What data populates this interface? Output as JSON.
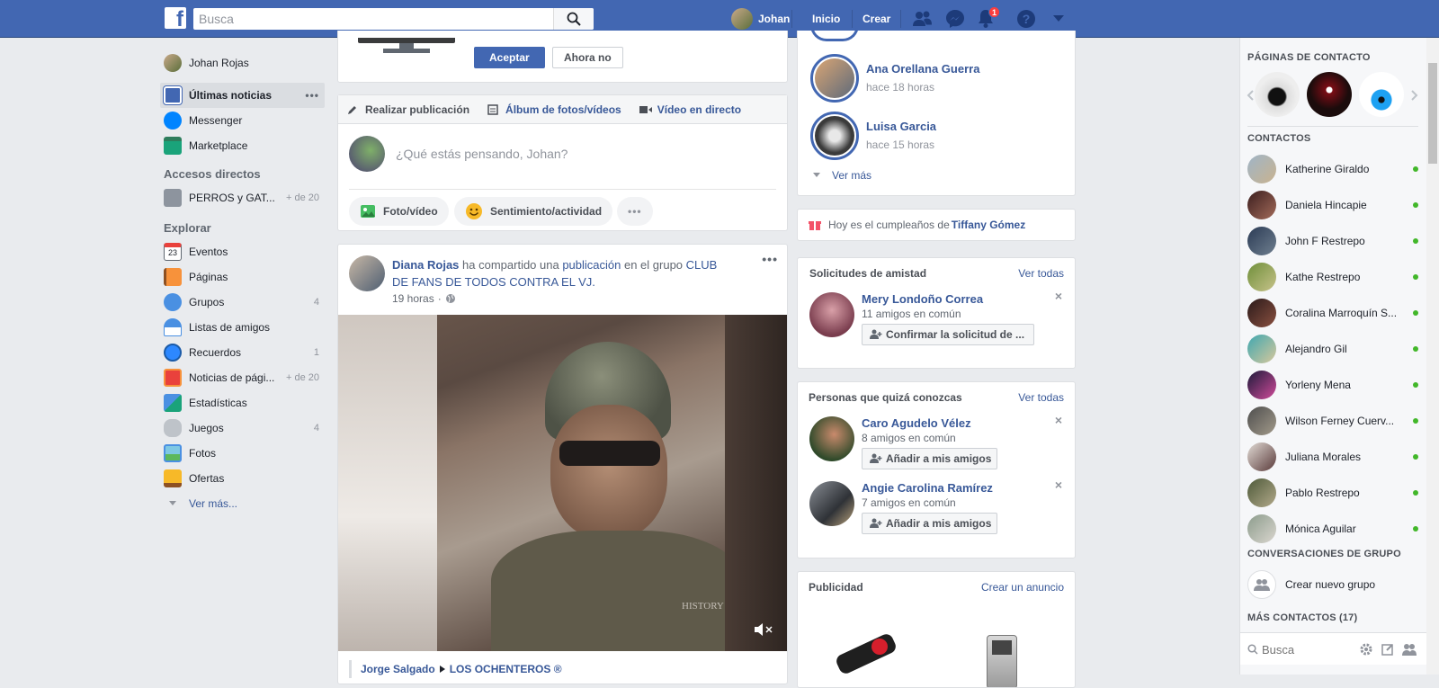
{
  "topbar": {
    "logo": "f",
    "search_placeholder": "Busca",
    "user_name": "Johan",
    "nav_home": "Inicio",
    "nav_create": "Crear",
    "notifications_count": "1",
    "color": "#4267b2"
  },
  "left_nav": {
    "profile_name": "Johan Rojas",
    "items_top": [
      {
        "label": "Últimas noticias",
        "more": "•••"
      },
      {
        "label": "Messenger"
      },
      {
        "label": "Marketplace"
      }
    ],
    "shortcuts_title": "Accesos directos",
    "shortcuts": [
      {
        "label": "PERROS y GAT...",
        "count": "+ de 20"
      }
    ],
    "explore_title": "Explorar",
    "explore": [
      {
        "label": "Eventos",
        "count": "",
        "icon_text": "23"
      },
      {
        "label": "Páginas",
        "count": ""
      },
      {
        "label": "Grupos",
        "count": "4"
      },
      {
        "label": "Listas de amigos",
        "count": ""
      },
      {
        "label": "Recuerdos",
        "count": "1"
      },
      {
        "label": "Noticias de pági...",
        "count": "+ de 20"
      },
      {
        "label": "Estadísticas",
        "count": ""
      },
      {
        "label": "Juegos",
        "count": "4"
      },
      {
        "label": "Fotos",
        "count": ""
      },
      {
        "label": "Ofertas",
        "count": ""
      }
    ],
    "see_more": "Ver más..."
  },
  "prompt_card": {
    "accept": "Aceptar",
    "not_now": "Ahora no"
  },
  "composer": {
    "tabs": [
      "Realizar publicación",
      "Álbum de fotos/vídeos",
      "Vídeo en directo"
    ],
    "placeholder": "¿Qué estás pensando, Johan?",
    "actions": [
      "Foto/vídeo",
      "Sentimiento/actividad",
      "•••"
    ]
  },
  "post": {
    "author": "Diana Rojas",
    "text1": " ha compartido una ",
    "link1": "publicación",
    "text2": " en el grupo ",
    "group": "CLUB DE FANS DE TODOS CONTRA EL VJ.",
    "time": "19 horas",
    "video_watermark": "HISTORY",
    "more": "•••",
    "footer_from": "Jorge Salgado",
    "footer_to": "LOS OCHENTEROS ®"
  },
  "stories": {
    "items": [
      {
        "name": "Ana Orellana Guerra",
        "time": "hace 18 horas"
      },
      {
        "name": "Luisa Garcia",
        "time": "hace 15 horas"
      }
    ],
    "see_more": "Ver más"
  },
  "birthday": {
    "text": "Hoy es el cumpleaños de ",
    "name": "Tiffany Gómez"
  },
  "friend_requests": {
    "title": "Solicitudes de amistad",
    "see_all": "Ver todas",
    "items": [
      {
        "name": "Mery Londoño Correa",
        "mutual": "11 amigos en común",
        "button": "Confirmar la solicitud de ..."
      }
    ]
  },
  "people_you_may_know": {
    "title": "Personas que quizá conozcas",
    "see_all": "Ver todas",
    "items": [
      {
        "name": "Caro Agudelo Vélez",
        "mutual": "8 amigos en común",
        "button": "Añadir a mis amigos"
      },
      {
        "name": "Angie Carolina Ramírez",
        "mutual": "7 amigos en común",
        "button": "Añadir a mis amigos"
      }
    ]
  },
  "ads": {
    "title": "Publicidad",
    "create": "Crear un anuncio"
  },
  "sidebar": {
    "pages_title": "PÁGINAS DE CONTACTO",
    "contacts_title": "CONTACTOS",
    "contacts": [
      "Katherine Giraldo",
      "Daniela Hincapie",
      "John F Restrepo",
      "Kathe Restrepo",
      "Coralina Marroquín S...",
      "Alejandro Gil",
      "Yorleny Mena",
      "Wilson Ferney Cuerv...",
      "Juliana Morales",
      "Pablo Restrepo",
      "Mónica Aguilar"
    ],
    "groups_title": "CONVERSACIONES DE GRUPO",
    "new_group": "Crear nuevo grupo",
    "more_contacts": "MÁS CONTACTOS (17)",
    "search_placeholder": "Busca"
  }
}
